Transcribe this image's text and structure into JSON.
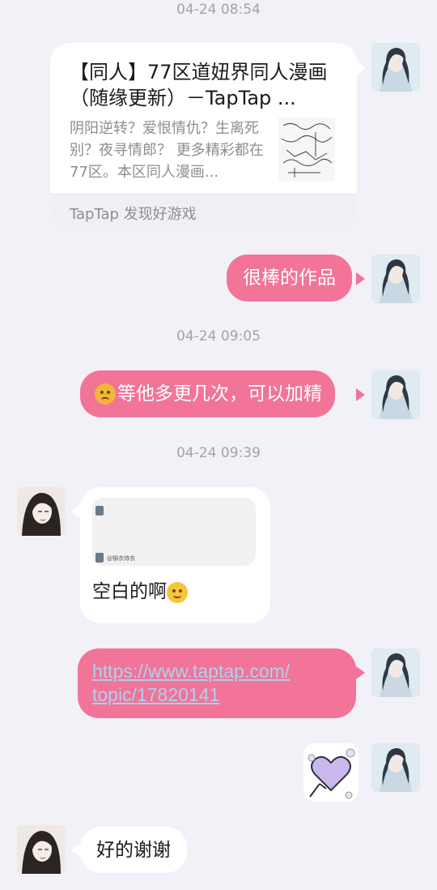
{
  "timestamps": [
    "04-24 08:54",
    "04-24 09:05",
    "04-24 09:39"
  ],
  "share_card": {
    "title": "【同人】77区道妞界同人漫画（随缘更新）－TapTap ...",
    "description": "阴阳逆转？爱恨情仇？生离死别？夜寻情郎？ 更多精彩都在77区。本区同人漫画...",
    "source": "TapTap 发现好游戏"
  },
  "messages": {
    "m1": "很棒的作品",
    "m2": "等他多更几次，可以加精",
    "m3_text": "空白的啊",
    "m3_screenshot_caption": "@锦衣侍衣",
    "m4_link_line1": "https://www.taptap.com/",
    "m4_link_line2": "topic/17820141",
    "m5": "好的谢谢"
  },
  "icons": {
    "self_avatar": "anime-man-avatar",
    "other_avatar": "anime-woman-avatar",
    "sticker": "purple-heart-sticker",
    "emoji_1": "frowning-face-emoji",
    "emoji_2": "smiling-face-emoji"
  },
  "colors": {
    "background": "#f2f1f8",
    "sent_bubble": "#f27498",
    "received_bubble": "#ffffff",
    "timestamp": "#a3a3ab",
    "link": "#a9d3ef"
  }
}
